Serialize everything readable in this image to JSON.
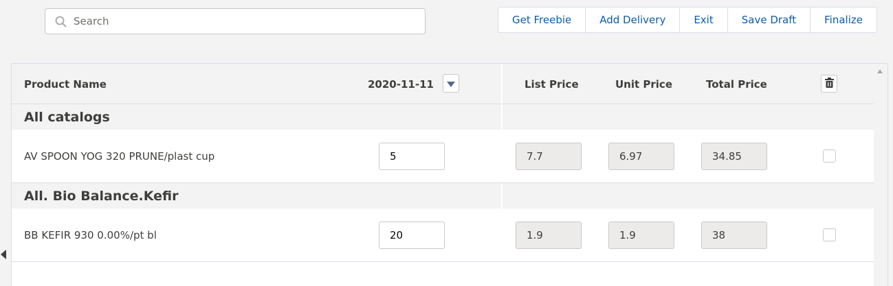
{
  "search": {
    "placeholder": "Search",
    "value": ""
  },
  "toolbar": {
    "buttons": [
      "Get Freebie",
      "Add Delivery",
      "Exit",
      "Save Draft",
      "Finalize"
    ]
  },
  "table": {
    "headers": {
      "product_name": "Product Name",
      "date": "2020-11-11",
      "list_price": "List Price",
      "unit_price": "Unit Price",
      "total_price": "Total Price"
    },
    "groups": [
      {
        "title": "All catalogs",
        "rows": [
          {
            "product": "AV SPOON YOG 320 PRUNE/plast cup",
            "quantity": "5",
            "list_price": "7.7",
            "unit_price": "6.97",
            "total_price": "34.85",
            "selected": false
          }
        ]
      },
      {
        "title": "All. Bio Balance.Kefir",
        "rows": [
          {
            "product": "BB KEFIR 930 0.00%/pt bl",
            "quantity": "20",
            "list_price": "1.9",
            "unit_price": "1.9",
            "total_price": "38",
            "selected": false
          }
        ]
      }
    ]
  },
  "icons": {
    "search": "search-icon",
    "date_dropdown": "chevron-down-icon",
    "delete": "trash-icon",
    "scroll_up": "scroll-up-arrow-icon",
    "collapse": "collapse-left-icon"
  },
  "colors": {
    "accent": "#0b5cab",
    "header_bg": "#f3f3f3",
    "border": "#d8dde6"
  }
}
